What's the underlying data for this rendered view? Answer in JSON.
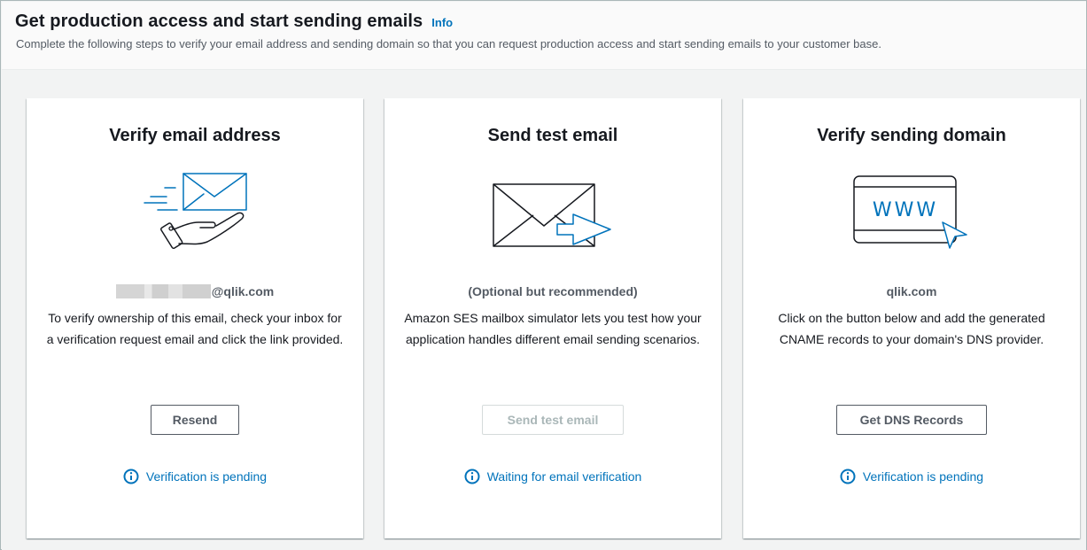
{
  "header": {
    "title": "Get production access and start sending emails",
    "info_label": "Info",
    "description": "Complete the following steps to verify your email address and sending domain so that you can request production access and start sending emails to your customer base."
  },
  "cards": [
    {
      "title": "Verify email address",
      "illustration": "email-hand-icon",
      "subtitle_suffix": "@qlik.com",
      "description": "To verify ownership of this email, check your inbox for a verification request email and click the link provided.",
      "button_label": "Resend",
      "status_icon": "info-icon",
      "status_text": "Verification is pending"
    },
    {
      "title": "Send test email",
      "illustration": "envelope-arrow-icon",
      "subtitle": "(Optional but recommended)",
      "description": "Amazon SES mailbox simulator lets you test how your application handles different email sending scenarios.",
      "button_label": "Send test email",
      "status_icon": "info-icon",
      "status_text": "Waiting for email verification"
    },
    {
      "title": "Verify sending domain",
      "illustration": "www-browser-icon",
      "subtitle": "qlik.com",
      "description": "Click on the button below and add the generated CNAME records to your domain's DNS provider.",
      "button_label": "Get DNS Records",
      "status_icon": "info-icon",
      "status_text": "Verification is pending"
    }
  ],
  "colors": {
    "accent_blue": "#0073bb",
    "illustration_blue": "#0073bb",
    "text_dark": "#16191f",
    "text_muted": "#545b64",
    "disabled": "#aab7b8",
    "background": "#f2f3f3"
  }
}
